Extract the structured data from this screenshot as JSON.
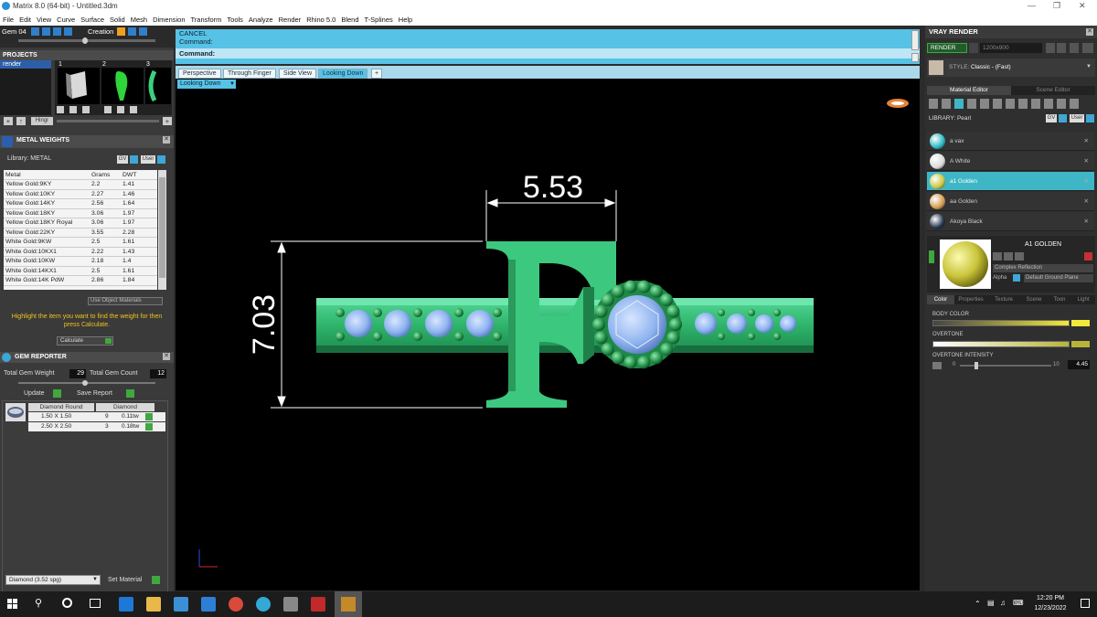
{
  "app": {
    "title": "Matrix 8.0 (64-bit) - Untitled.3dm"
  },
  "menu": [
    "File",
    "Edit",
    "View",
    "Curve",
    "Surface",
    "Solid",
    "Mesh",
    "Dimension",
    "Transform",
    "Tools",
    "Analyze",
    "Render",
    "Rhino 5.0",
    "Blend",
    "T-Splines",
    "Help"
  ],
  "toolbar": {
    "gem_label": "Gem 04",
    "creation_label": "Creation"
  },
  "projects": {
    "header": "PROJECTS",
    "item": "render",
    "thumb_numbers": [
      "1",
      "2",
      "3"
    ],
    "hinge_label": "Hingr"
  },
  "metal_weights": {
    "header": "METAL WEIGHTS",
    "library_label": "Library: METAL",
    "btn_gv": "GV",
    "btn_user": "User",
    "columns": [
      "Metal",
      "Grams",
      "DWT"
    ],
    "rows": [
      [
        "Yellow Gold:9KY",
        "2.2",
        "1.41"
      ],
      [
        "Yellow Gold:10KY",
        "2.27",
        "1.46"
      ],
      [
        "Yellow Gold:14KY",
        "2.56",
        "1.64"
      ],
      [
        "Yellow Gold:18KY",
        "3.06",
        "1.97"
      ],
      [
        "Yellow Gold:18KY Royal",
        "3.06",
        "1.97"
      ],
      [
        "Yellow Gold:22KY",
        "3.55",
        "2.28"
      ],
      [
        "White Gold:9KW",
        "2.5",
        "1.61"
      ],
      [
        "White Gold:10KX1",
        "2.22",
        "1.43"
      ],
      [
        "White Gold:10KW",
        "2.18",
        "1.4"
      ],
      [
        "White Gold:14KX1",
        "2.5",
        "1.61"
      ],
      [
        "White Gold:14K PdW",
        "2.86",
        "1.84"
      ]
    ],
    "use_object_materials": "Use Object Materials",
    "hint": "Highlight the item you want to find the weight for then press Calculate.",
    "calculate_label": "Calculate"
  },
  "gem_reporter": {
    "header": "GEM REPORTER",
    "total_weight_label": "Total Gem Weight",
    "total_weight_value": "29",
    "total_count_label": "Total Gem Count",
    "total_count_value": "12",
    "update_label": "Update",
    "save_report_label": "Save Report",
    "columns": [
      "Diamond Round",
      "Diamond"
    ],
    "rows": [
      {
        "size": "1.50 X 1.50",
        "count": "9",
        "tw": "0.11tw"
      },
      {
        "size": "2.50 X 2.50",
        "count": "3",
        "tw": "0.18tw"
      }
    ]
  },
  "material_select": {
    "value": "Diamond    (3.52 spg)",
    "set_label": "Set Material"
  },
  "command": {
    "line1": "CANCEL",
    "line2": "Command:",
    "line3": "Command:"
  },
  "view_tabs": [
    "Perspective",
    "Through Finger",
    "Side View",
    "Looking Down"
  ],
  "active_view": "Looking Down",
  "dimensions": {
    "width": "5.53",
    "height": "7.03"
  },
  "right": {
    "header": "VRAY RENDER",
    "render_label": "RENDER",
    "resolution": "1200x900",
    "style_label": "STYLE:",
    "style_value": "Classic - (Fast)",
    "tabs": [
      "Material Editor",
      "Scene Editor"
    ],
    "library_label": "LIBRARY: Pearl",
    "btn_gv": "GV",
    "btn_user": "User",
    "materials": [
      {
        "name": "a vax",
        "color": "#2ab8c4"
      },
      {
        "name": "A White",
        "color": "#d9d9d9"
      },
      {
        "name": "a1 Golden",
        "color": "#c9c43a"
      },
      {
        "name": "aa Golden",
        "color": "#d49a4c"
      },
      {
        "name": "Akoya Black",
        "color": "#22314a"
      }
    ],
    "selected_name": "A1 GOLDEN",
    "reflection": "Complex Reflection",
    "alpha_label": "Alpha",
    "ground": "Default Ground Plane",
    "prop_tabs": [
      "Color",
      "Properties",
      "Texture",
      "Scene",
      "Toon",
      "Light"
    ],
    "body_color_label": "BODY COLOR",
    "overtone_label": "OVERTONE",
    "overtone_intensity_label": "OVERTONE INTENSITY",
    "intensity_min": "0",
    "intensity_max": "10",
    "intensity_value": "4.45"
  },
  "taskbar": {
    "time": "12:20 PM",
    "date": "12/23/2022"
  },
  "colors": {
    "accent": "#56c2e6",
    "ring_green": "#3cc87f",
    "stone_blue": "#8fb4ef",
    "gold_swatch": "#d8d63a"
  }
}
